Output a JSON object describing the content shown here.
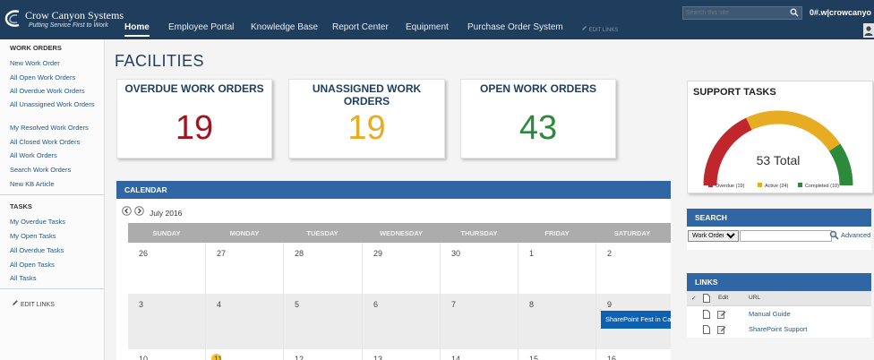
{
  "brand": {
    "title": "Crow Canyon Systems",
    "tagline": "Putting Service First to Work"
  },
  "nav": {
    "items": [
      "Home",
      "Employee Portal",
      "Knowledge Base",
      "Report Center",
      "Equipment",
      "Purchase Order System"
    ],
    "active": "Home",
    "edit_links": "EDIT LINKS"
  },
  "top_search": {
    "placeholder": "Search this site"
  },
  "user": {
    "name": "0#.w|crowcanyo"
  },
  "sidebar": {
    "sections": [
      {
        "heading": "WORK ORDERS",
        "links": [
          "New Work Order",
          "All Open Work Orders",
          "All Overdue Work Orders",
          "All Unassigned Work Orders",
          "My Resolved Work Orders",
          "All Closed Work Orders",
          "All Work Orders",
          "Search Work Orders",
          "New KB Article"
        ]
      },
      {
        "heading": "TASKS",
        "links": [
          "My Overdue Tasks",
          "My Open Tasks",
          "All Overdue Tasks",
          "All Open Tasks",
          "All Tasks"
        ]
      }
    ],
    "edit_links": "EDIT LINKS"
  },
  "page": {
    "title": "FACILITIES"
  },
  "kpis": [
    {
      "title": "OVERDUE WORK ORDERS",
      "value": "19",
      "color": "#a5121c"
    },
    {
      "title": "UNASSIGNED WORK ORDERS",
      "value": "19",
      "color": "#e8ac22"
    },
    {
      "title": "OPEN WORK ORDERS",
      "value": "43",
      "color": "#2b8a3c"
    }
  ],
  "support_tasks": {
    "title": "SUPPORT TASKS",
    "total_label": "53 Total",
    "segments": [
      {
        "name": "Overdue (19)",
        "value": 19,
        "color": "#c0272d"
      },
      {
        "name": "Active (24)",
        "value": 24,
        "color": "#e8ac22"
      },
      {
        "name": "Completed (10)",
        "value": 10,
        "color": "#2d8a3a"
      }
    ]
  },
  "calendar": {
    "title": "CALENDAR",
    "month": "July 2016",
    "weekdays": [
      "SUNDAY",
      "MONDAY",
      "TUESDAY",
      "WEDNESDAY",
      "THURSDAY",
      "FRIDAY",
      "SATURDAY"
    ],
    "weeks": [
      [
        "26",
        "27",
        "28",
        "29",
        "30",
        "1",
        "2"
      ],
      [
        "3",
        "4",
        "5",
        "6",
        "7",
        "8",
        "9"
      ],
      [
        "10",
        "11",
        "12",
        "13",
        "14",
        "15",
        "16"
      ]
    ],
    "event": {
      "label": "SharePoint Fest in Ca"
    }
  },
  "search_panel": {
    "title": "SEARCH",
    "scope": "Work Orders",
    "advanced": "Advanced"
  },
  "links_panel": {
    "title": "LINKS",
    "col_edit": "Edit",
    "col_url": "URL",
    "check": "✓",
    "items": [
      "Manual Guide",
      "SharePoint Support"
    ]
  }
}
